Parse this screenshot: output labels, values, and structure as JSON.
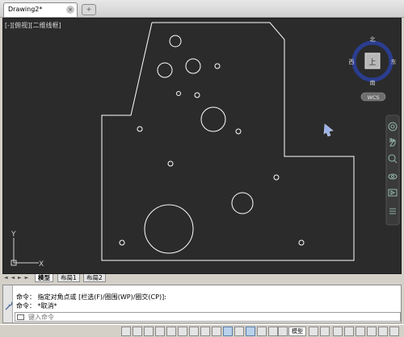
{
  "tabs": {
    "document_tab": "Drawing2*",
    "close_glyph": "×",
    "new_tab_glyph": "+"
  },
  "viewport": {
    "label": "[-][俯视][二维线框]",
    "viewcube": {
      "north": "北",
      "south": "南",
      "east": "东",
      "west": "西",
      "face": "上",
      "wcs": "WCS"
    },
    "ucs": {
      "y_label": "Y",
      "x_label": "X"
    }
  },
  "layouts": {
    "model": "模型",
    "layout1": "布局1",
    "layout2": "布局2",
    "nav_glyph": "◄ ◄ ► ►"
  },
  "command": {
    "line1": "命令： 指定对角点或 [栏选(F)/圈围(WP)/圈交(CP)]:",
    "line2": "命令： *取消*",
    "placeholder": "键入命令"
  },
  "statusbar": {
    "model_label": "模型"
  },
  "colors": {
    "viewport_bg": "#2b2b2b",
    "geometry": "#ffffff",
    "viewcube_ring": "#2b3d8f",
    "accent": "#5a7fa8"
  }
}
